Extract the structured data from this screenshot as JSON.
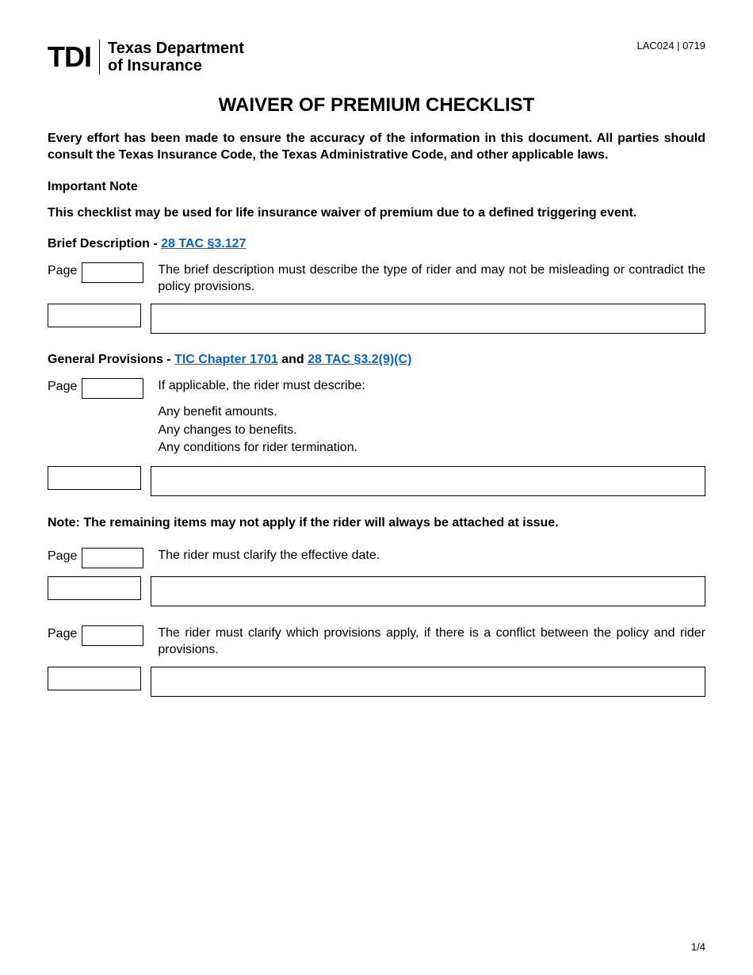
{
  "doc_id": "LAC024 | 0719",
  "logo": {
    "abbrev": "TDI",
    "dept_line1": "Texas Department",
    "dept_line2": "of Insurance"
  },
  "title": "WAIVER OF PREMIUM CHECKLIST",
  "intro": "Every effort has been made to ensure the accuracy of the information in this document. All parties should consult the Texas Insurance Code, the Texas Administrative Code, and other applicable laws.",
  "important_note_label": "Important Note",
  "important_note_text": "This checklist may be used for life insurance waiver of premium due to a defined triggering event.",
  "sections": {
    "brief": {
      "heading_prefix": "Brief Description - ",
      "link": "28 TAC §3.127",
      "page_label": "Page",
      "item_text": "The brief description must describe the type of rider and may not be misleading or contradict the policy provisions."
    },
    "general": {
      "heading_prefix": "General Provisions - ",
      "link1": "TIC Chapter 1701",
      "and": " and ",
      "link2": "28 TAC §3.2(9)(C)",
      "page_label": "Page",
      "item_intro": "If applicable, the rider must describe:",
      "item_list": [
        "Any benefit amounts.",
        "Any changes to benefits.",
        "Any conditions for rider termination."
      ]
    },
    "note": "Note:  The remaining items may not apply if the rider will always be attached at issue.",
    "effective": {
      "page_label": "Page",
      "item_text": "The rider must clarify the effective date."
    },
    "conflict": {
      "page_label": "Page",
      "item_text": "The rider must clarify which provisions apply, if there is a conflict between the policy and rider provisions."
    }
  },
  "footer": "1/4"
}
